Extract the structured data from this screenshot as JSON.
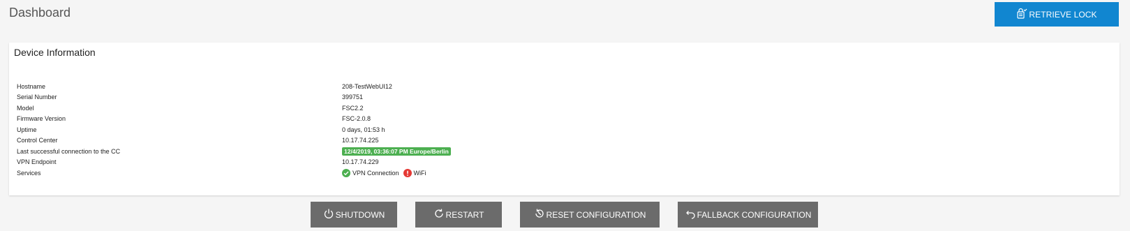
{
  "header": {
    "title": "Dashboard",
    "retrieve_lock_label": "RETRIEVE LOCK"
  },
  "device_info": {
    "title": "Device Information",
    "rows": [
      {
        "label": "Hostname",
        "value": "208-TestWebUI12"
      },
      {
        "label": "Serial Number",
        "value": "399751"
      },
      {
        "label": "Model",
        "value": "FSC2.2"
      },
      {
        "label": "Firmware Version",
        "value": "FSC-2.0.8"
      },
      {
        "label": "Uptime",
        "value": "0 days, 01:53 h"
      },
      {
        "label": "Control Center",
        "value": "10.17.74.225"
      },
      {
        "label": "Last successful connection to the CC",
        "value": "12/4/2019, 03:36:07 PM Europe/Berlin"
      },
      {
        "label": "VPN Endpoint",
        "value": "10.17.74.229"
      },
      {
        "label": "Services",
        "value": ""
      }
    ],
    "services": [
      {
        "name": "VPN Connection",
        "status": "ok",
        "color": "#4caf50"
      },
      {
        "name": "WiFi",
        "status": "error",
        "color": "#e53935"
      }
    ],
    "badge_color": "#4caf50"
  },
  "actions": {
    "shutdown_label": "SHUTDOWN",
    "restart_label": "RESTART",
    "reset_label": "RESET CONFIGURATION",
    "fallback_label": "FALLBACK CONFIGURATION"
  },
  "colors": {
    "primary_button": "#1186d0",
    "action_button": "#6b6b6b",
    "background": "#f5f5f5"
  }
}
